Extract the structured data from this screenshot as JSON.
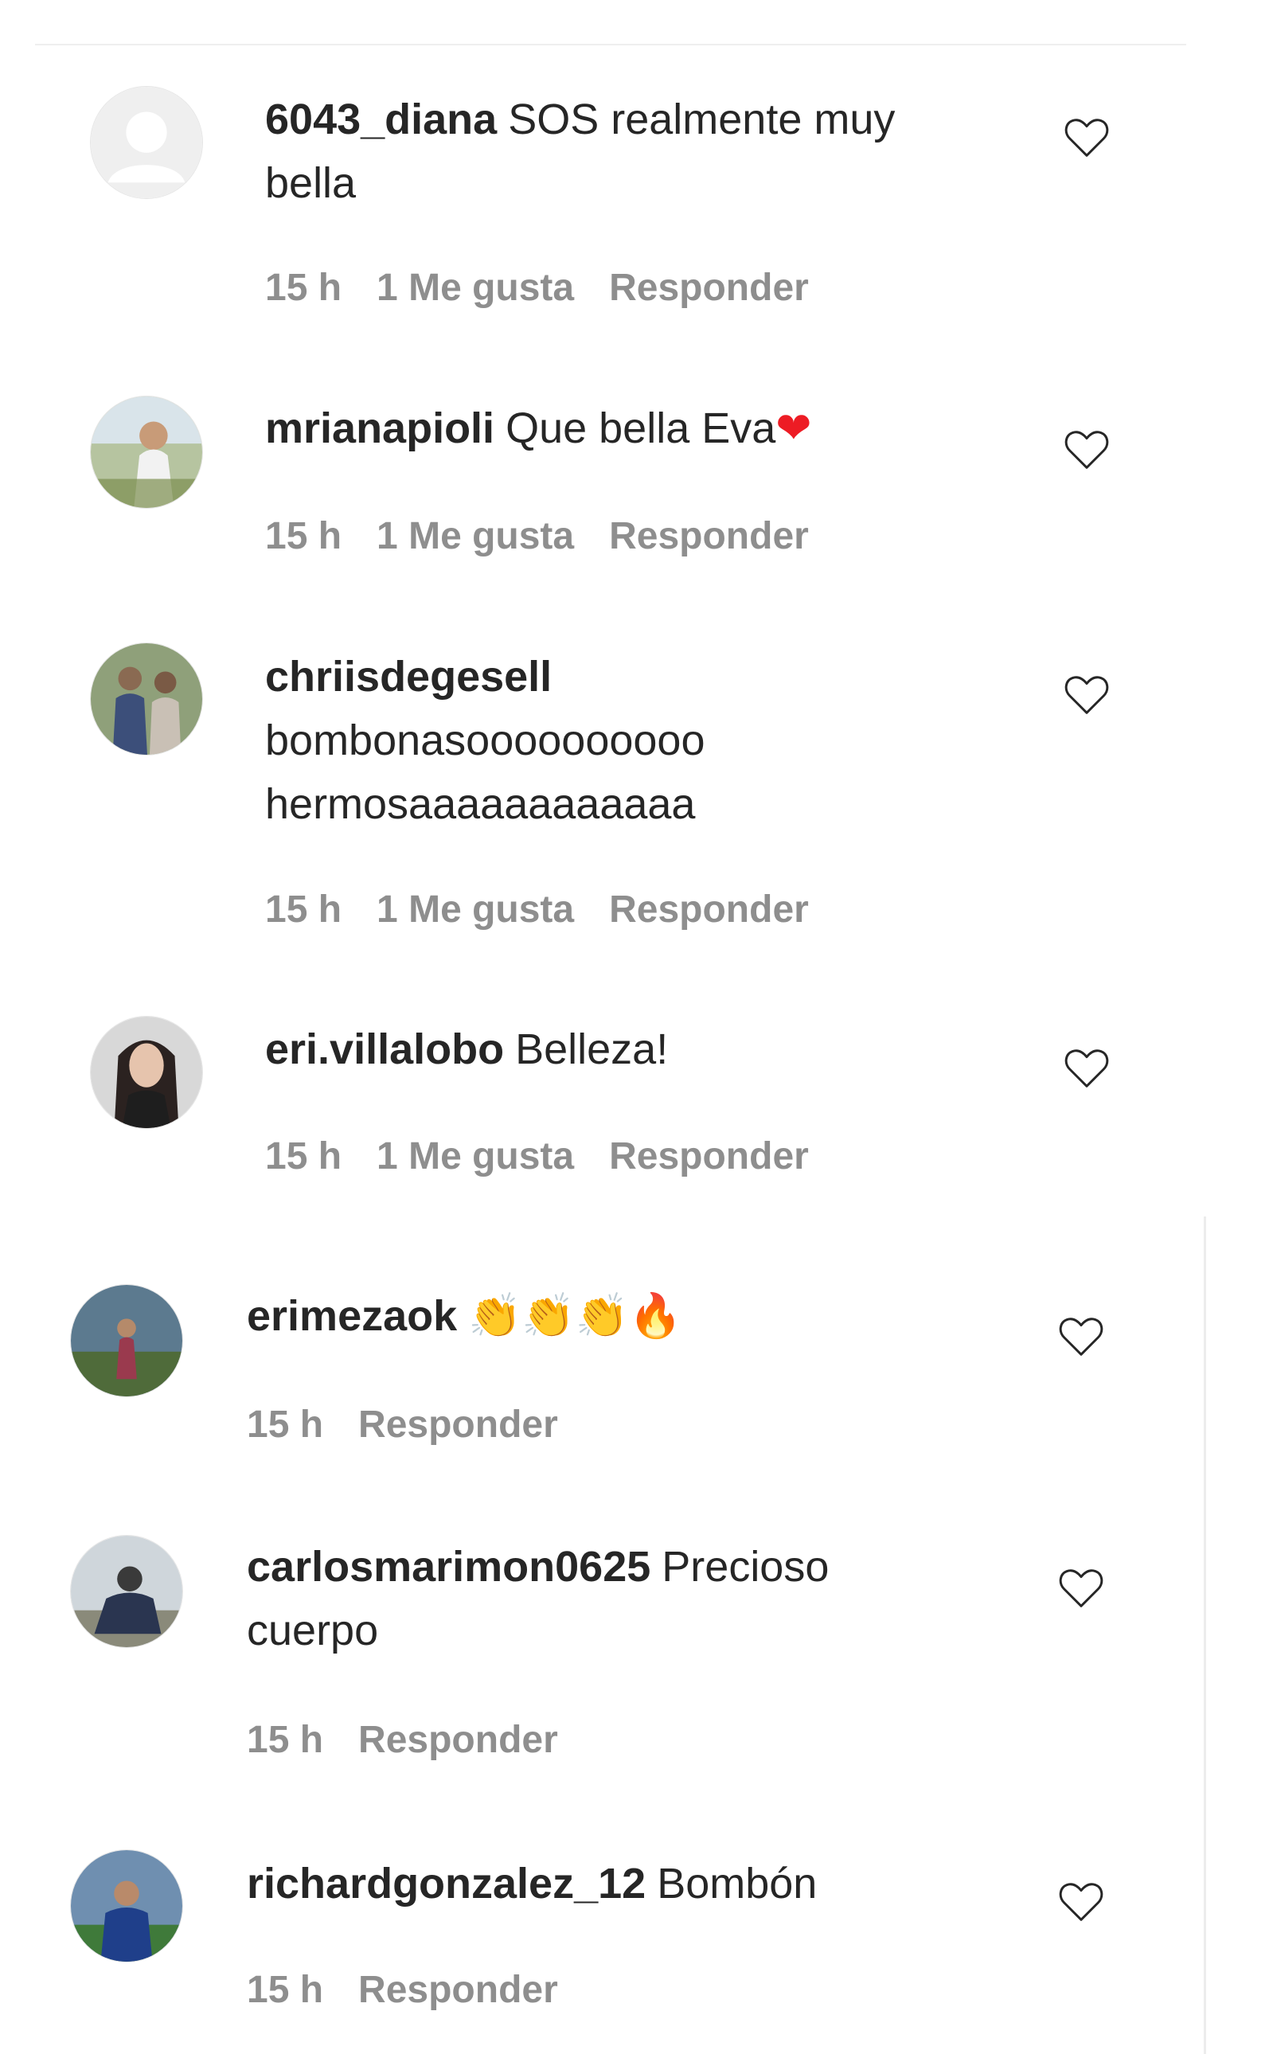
{
  "comments": [
    {
      "username": "6043_diana",
      "text": "SOS realmente muy bella",
      "time": "15 h",
      "likes": "1 Me gusta",
      "reply": "Responder"
    },
    {
      "username": "mrianapioli",
      "text": "Que bella Eva",
      "emoji": "❤",
      "time": "15 h",
      "likes": "1 Me gusta",
      "reply": "Responder"
    },
    {
      "username": "chriisdegesell",
      "text": "bombonasoooooooooo hermosaaaaaaaaaaaa",
      "time": "15 h",
      "likes": "1 Me gusta",
      "reply": "Responder"
    },
    {
      "username": "eri.villalobo",
      "text": "Belleza!",
      "time": "15 h",
      "likes": "1 Me gusta",
      "reply": "Responder"
    },
    {
      "username": "erimezaok",
      "text": "",
      "emoji": "👏👏👏🔥",
      "time": "15 h",
      "reply": "Responder"
    },
    {
      "username": "carlosmarimon0625",
      "text": "Precioso cuerpo",
      "time": "15 h",
      "reply": "Responder"
    },
    {
      "username": "richardgonzalez_12",
      "text": "Bombón",
      "time": "15 h",
      "reply": "Responder"
    }
  ],
  "colors": {
    "text": "#262626",
    "meta": "#8e8e8e",
    "divider": "#efefef",
    "heart_outline": "#262626",
    "emoji_heart": "#ed1c24"
  },
  "icons": {
    "like": "heart-outline-icon",
    "avatar_placeholder": "default-avatar-icon"
  }
}
